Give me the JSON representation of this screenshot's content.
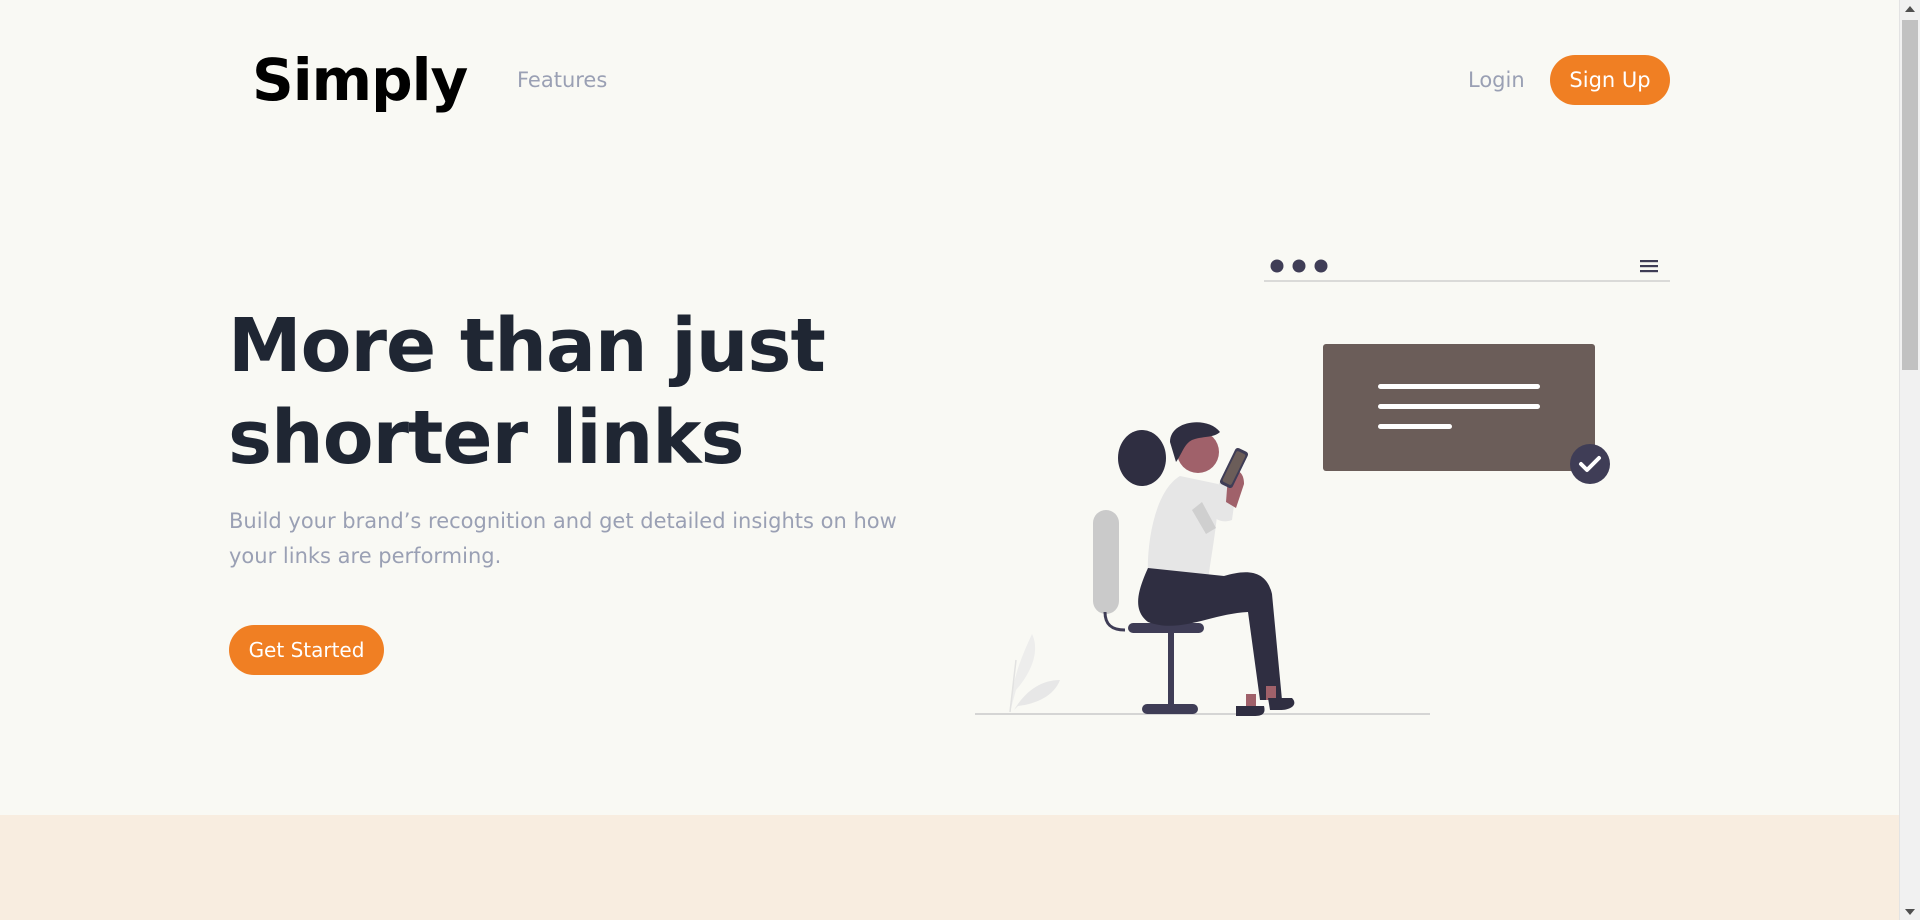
{
  "header": {
    "logo": "Simply",
    "nav": {
      "features": "Features"
    },
    "login": "Login",
    "signup": "Sign Up"
  },
  "hero": {
    "title": "More than just shorter links",
    "subtitle": "Build your brand’s recognition and get detailed insights on how your links are performing.",
    "cta": "Get Started"
  },
  "illustration": {
    "description_icon": "woman-on-chair-with-phone-illustration",
    "check_icon": "check-icon",
    "menu_icon": "hamburger-menu-icon"
  },
  "colors": {
    "accent": "#f07f23",
    "heading": "#1f2633",
    "muted": "#9aa0b4",
    "background": "#f9f9f4",
    "band": "#f8ede0"
  }
}
